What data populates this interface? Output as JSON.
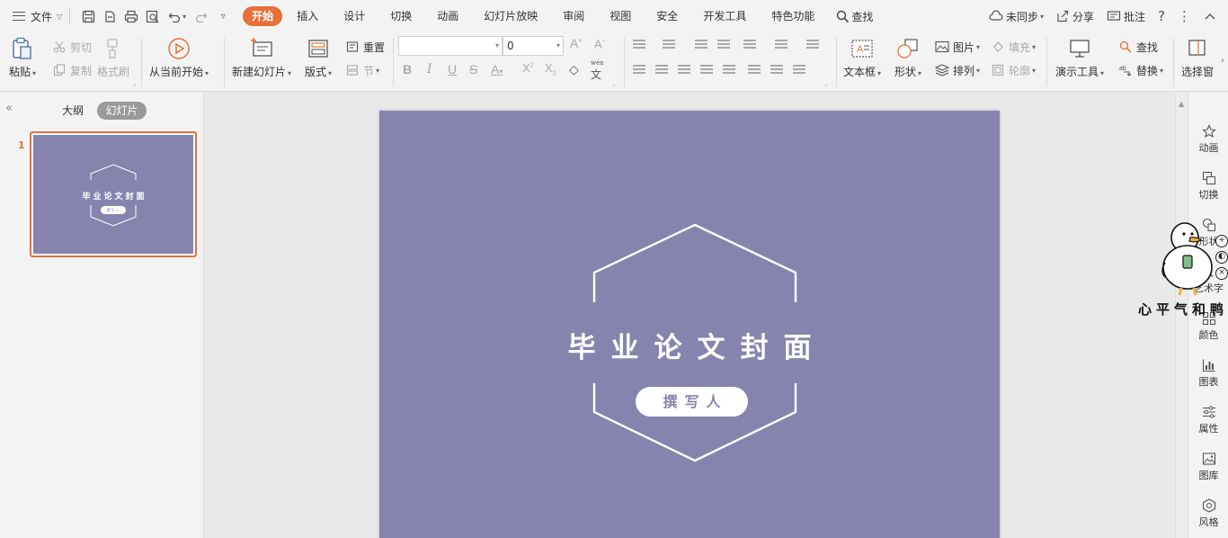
{
  "menubar": {
    "file_label": "文件",
    "tabs": [
      "开始",
      "插入",
      "设计",
      "切换",
      "动画",
      "幻灯片放映",
      "审阅",
      "视图",
      "安全",
      "开发工具",
      "特色功能"
    ],
    "search_label": "查找",
    "sync_label": "未同步",
    "share_label": "分享",
    "comment_label": "批注",
    "help_label": "?",
    "accent_color": "#e8703a"
  },
  "ribbon": {
    "paste": "粘贴",
    "cut": "剪切",
    "copy": "复制",
    "format_painter": "格式刷",
    "from_current": "从当前开始",
    "new_slide": "新建幻灯片",
    "layout": "版式",
    "reset": "重置",
    "section": "节",
    "font_name": "",
    "font_size": "0",
    "text_box": "文本框",
    "shape": "形状",
    "picture": "图片",
    "fill": "填充",
    "arrange": "排列",
    "outline": "轮廓",
    "present_tools": "演示工具",
    "find": "查找",
    "replace": "替换",
    "select_pane": "选择窗"
  },
  "left_panel": {
    "outline_tab": "大纲",
    "slides_tab": "幻灯片",
    "slide_number": "1",
    "thumb_title": "毕业论文封面",
    "thumb_pill": "撰写人"
  },
  "slide": {
    "background": "#8684ae",
    "title": "毕业论文封面",
    "pill_text": "撰写人"
  },
  "right_panel": {
    "tools": [
      "动画",
      "切换",
      "形状",
      "艺术字",
      "颜色",
      "图表",
      "属性",
      "图库",
      "风格"
    ]
  },
  "sticker": {
    "text": "心平气和鸭"
  }
}
